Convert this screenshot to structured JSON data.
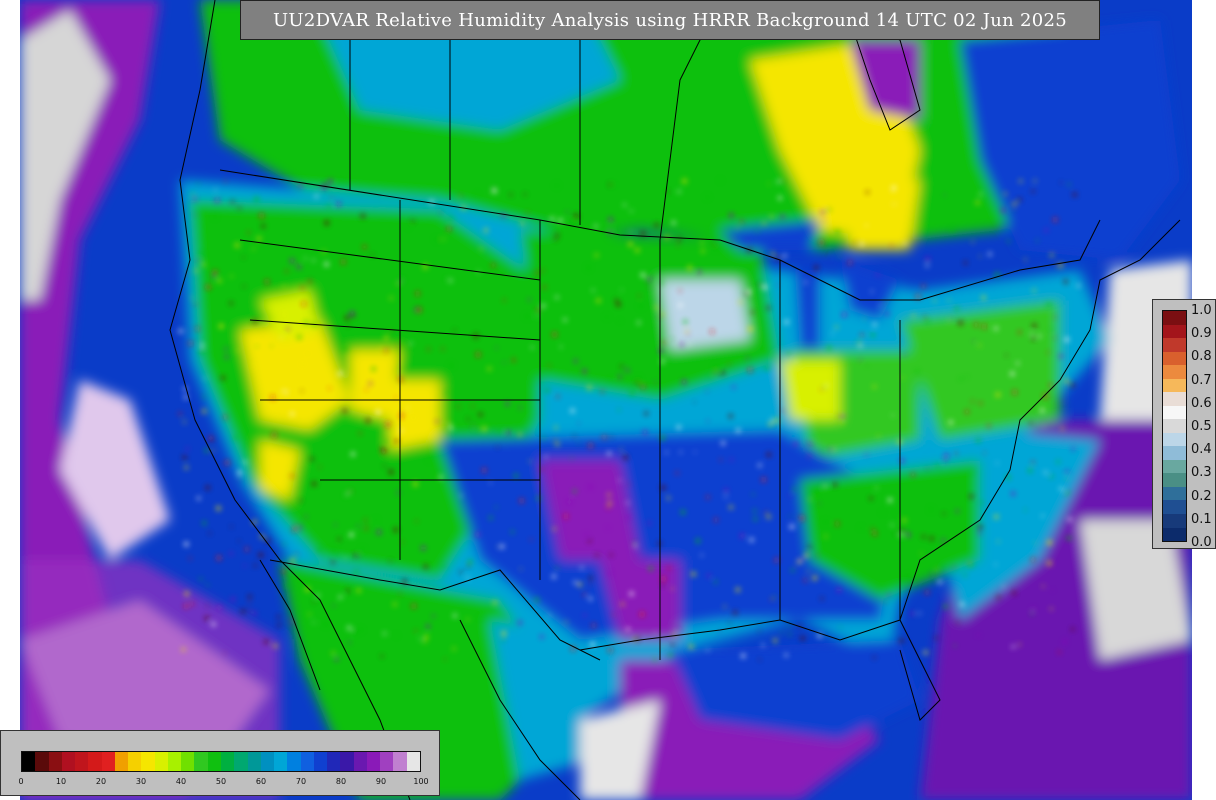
{
  "title": "UU2DVAR Relative Humidity Analysis using HRRR Background 14 UTC 02 Jun 2025",
  "colors": {
    "ocean_moist": "#0a3cc8",
    "dry_red": "#b01020",
    "yellow": "#f5e600",
    "green": "#10c010",
    "cyan": "#00a6d6",
    "purple": "#8a1ab8",
    "white_sat": "#e6e6e6"
  },
  "legend_right": {
    "ticks": [
      "1.0",
      "0.9",
      "0.8",
      "0.7",
      "0.6",
      "0.5",
      "0.4",
      "0.3",
      "0.2",
      "0.1",
      "0.0"
    ],
    "colors": [
      "#7b0f12",
      "#a3151b",
      "#c0392b",
      "#d9602d",
      "#ec8a3e",
      "#f6b85a",
      "#e9ddd6",
      "#f7f7f7",
      "#d9d9d9",
      "#bcd6e8",
      "#8fbcd8",
      "#69a8a0",
      "#4a8f85",
      "#2f6f9a",
      "#1f4f92",
      "#173a7a",
      "#0c2b6b"
    ]
  },
  "legend_bottom": {
    "ticks": [
      "0",
      "10",
      "20",
      "30",
      "40",
      "50",
      "60",
      "70",
      "80",
      "90",
      "100"
    ],
    "colors": [
      "#000000",
      "#5a0a0a",
      "#8a0f12",
      "#b01020",
      "#c0151c",
      "#d41a1a",
      "#e02020",
      "#f0a000",
      "#f5d000",
      "#f5e600",
      "#d8f000",
      "#a8f000",
      "#70e000",
      "#30c820",
      "#10c010",
      "#00b040",
      "#00a870",
      "#009898",
      "#0090c0",
      "#00a6d6",
      "#0080e0",
      "#1060e0",
      "#1040d0",
      "#2028b8",
      "#3a18a8",
      "#6a18b0",
      "#8a1ab8",
      "#a040c0",
      "#c080d0",
      "#e6e6e6"
    ]
  }
}
